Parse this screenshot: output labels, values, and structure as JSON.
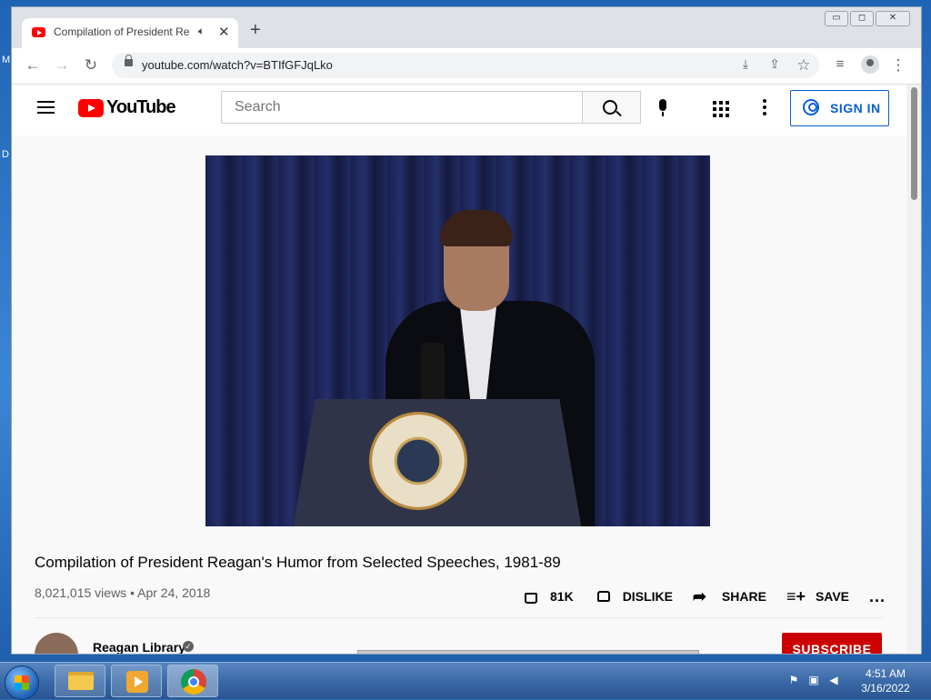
{
  "desktop": {
    "letters": [
      "M",
      "D"
    ]
  },
  "browser": {
    "tab": {
      "title": "Compilation of President Rea",
      "audio_icon": "speaker-icon",
      "close_label": "✕"
    },
    "new_tab_label": "+",
    "window_controls": [
      "▭",
      "◻",
      "✕"
    ],
    "url": "youtube.com/watch?v=BTIfGFJqLko"
  },
  "youtube": {
    "logo_text": "YouTube",
    "search": {
      "placeholder": "Search",
      "value": ""
    },
    "sign_in_label": "SIGN IN",
    "video": {
      "title": "Compilation of President Reagan's Humor from Selected Speeches, 1981-89",
      "views": "8,021,015 views",
      "separator": "•",
      "date": "Apr 24, 2018",
      "likes": "81K",
      "dislike_label": "DISLIKE",
      "share_label": "SHARE",
      "save_label": "SAVE",
      "more_label": "..."
    },
    "channel": {
      "name": "Reagan Library",
      "verified_mark": "✓",
      "subscribe_label": "SUBSCRIBE"
    }
  },
  "taskbar": {
    "items": [
      "explorer",
      "media-player",
      "chrome"
    ],
    "clock": {
      "time": "4:51 AM",
      "date": "3/16/2022"
    }
  }
}
